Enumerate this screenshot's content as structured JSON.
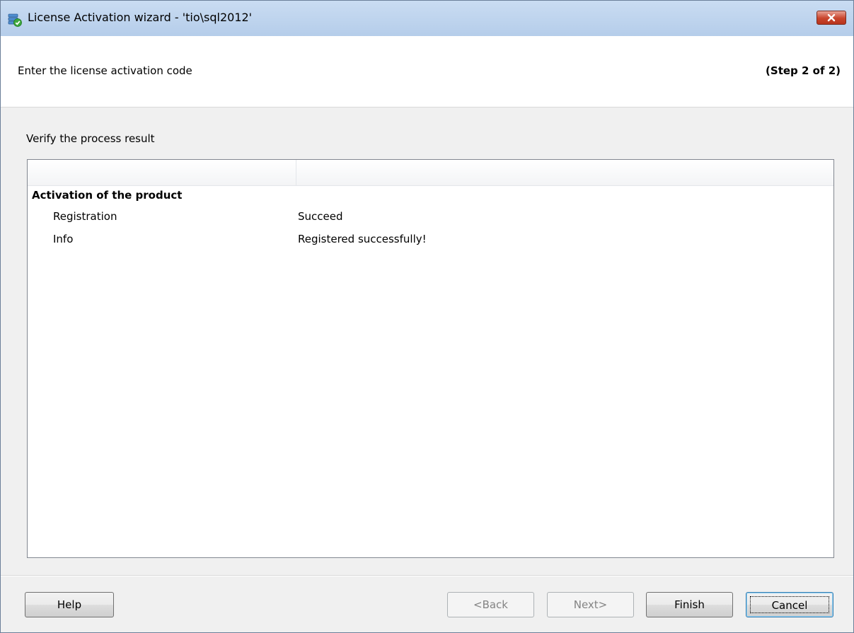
{
  "window": {
    "title": "License Activation wizard - 'tio\\sql2012'",
    "app_icon": "database-check-icon",
    "close_icon": "close-icon"
  },
  "header": {
    "title": "Enter the license activation code",
    "step": "(Step 2 of 2)"
  },
  "main": {
    "section_label": "Verify the process result",
    "results": {
      "columns": [
        "",
        ""
      ],
      "group": "Activation of the product",
      "rows": [
        {
          "name": "Registration",
          "value": "Succeed"
        },
        {
          "name": "Info",
          "value": "Registered successfully!"
        }
      ]
    }
  },
  "buttons": {
    "help": "Help",
    "back": "<Back",
    "next": "Next>",
    "finish": "Finish",
    "cancel": "Cancel"
  },
  "colors": {
    "titlebar": "#b9d1ea",
    "close_button": "#c8442c",
    "panel_bg": "#f0f0f0",
    "header_bg": "#ffffff"
  }
}
